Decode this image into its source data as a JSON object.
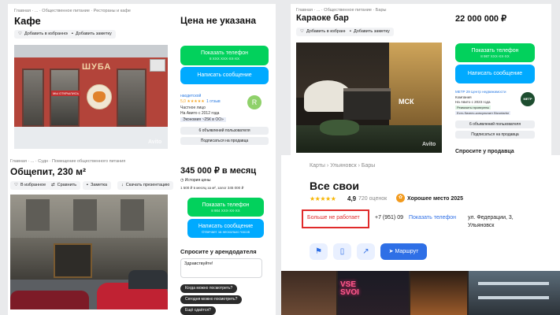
{
  "cafe": {
    "breadcrumb": "Главная · ... · Общественное питание · Рестораны и кафе",
    "title": "Кафе",
    "fav": "Добавить в избранное",
    "note": "Добавить заметку",
    "price": "Цена не указана",
    "btn_phone": "Показать телефон",
    "btn_phone_sub": "8 XXX XXX-XX-XX",
    "btn_msg": "Написать сообщение",
    "seller_name": "наодетской",
    "rating": "5,0 ★★★★★",
    "reviews": "1 отзыв",
    "seller_type": "Частное лицо",
    "since": "На Авито с 2012 года",
    "badge": "Экономия ~25К в ОО»",
    "avatar": "R",
    "ads_btn": "6 объявлений пользователя",
    "subscribe_btn": "Подписаться на продавца",
    "sign_shuba": "ШУБА",
    "sign_open": "МЫ ОТКРЫЛИСЬ",
    "avito": "Avito"
  },
  "obshepit": {
    "breadcrumb": "Главная · ... · Судн · Помещение общественного питания",
    "title": "Общепит, 230 м²",
    "actions": [
      "В избранное",
      "Сравнить",
      "Заметка",
      "Скачать презентацию"
    ],
    "price": "345 000 ₽ в месяц",
    "history": "История цены",
    "price_sub": "1 500 ₽ в месяц за м², залог 345 000 ₽",
    "btn_phone": "Показать телефон",
    "btn_phone_sub": "8 904 XXX-XX-XX",
    "btn_msg": "Написать сообщение",
    "btn_msg_sub": "Отвечает за несколько часов",
    "ask_title": "Спросите у арендодателя",
    "ask_placeholder": "Здравствуйте!",
    "questions": [
      "Когда можно посмотреть?",
      "Сегодня можно посмотреть?",
      "Ещё сдаётся?"
    ]
  },
  "karaoke": {
    "breadcrumb": "Главная · ... · Общественное питание · Бары",
    "title": "Караоке бар",
    "fav": "Добавить в избранное",
    "note": "Добавить заметку",
    "price": "22 000 000 ₽",
    "btn_phone": "Показать телефон",
    "btn_phone_sub": "8 987 XXX-XX-XX",
    "btn_msg": "Написать сообщение",
    "seller_name": "МЕТР 29 Центр недвижимости",
    "seller_type": "Компания",
    "since": "На Авито с 2023 года",
    "badge1": "Реквизиты проверены",
    "badge2": "Есть бизнес-консультант Bizontarbe",
    "logo": "МЕТР",
    "ads_btn": "6 объявлений пользователя",
    "subscribe_btn": "Подписаться на продавца",
    "ask": "Спросите у продавца",
    "sign": "МСК",
    "avito": "Avito"
  },
  "maps": {
    "breadcrumb": [
      "Карты",
      "Ульяновск",
      "Бары"
    ],
    "title": "Все свои",
    "rating": "4,9",
    "stars": "★★★★★",
    "reviews": "720 оценок",
    "good_place": "Хорошее место 2025",
    "closed": "Больше не работает",
    "phone": "+7 (951) 09",
    "show_phone": "Показать телефон",
    "address_line1": "ул. Федерации, 3,",
    "address_line2": "Ульяновск",
    "route": "Маршрут",
    "neon": "VSE\nSVOI"
  },
  "colors": {
    "green": "#02d15c",
    "blue": "#00aaff",
    "maps_blue": "#2e6fe6",
    "closed_red": "#e02b2b"
  }
}
